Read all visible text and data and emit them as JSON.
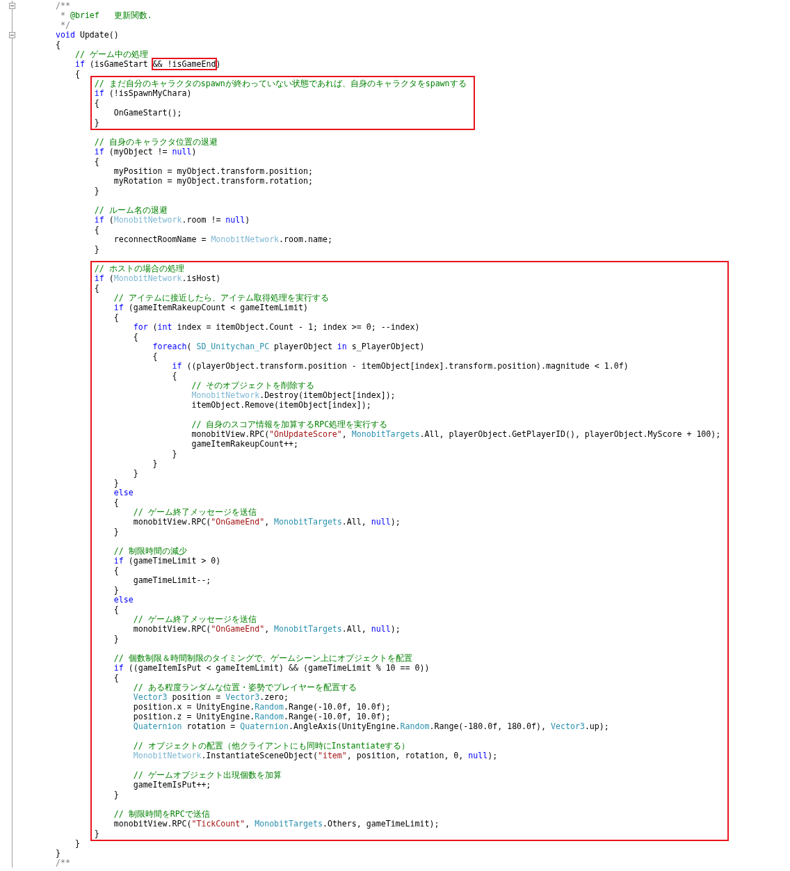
{
  "segments": [
    {
      "highlighted": false,
      "lines": [
        {
          "kind": "fold",
          "tokens": [
            {
              "kind": "dc",
              "text": "/**"
            }
          ]
        },
        {
          "kind": "code",
          "tokens": [
            {
              "kind": "dc",
              "text": " * "
            },
            {
              "kind": "c",
              "text": "@brief   更新関数."
            }
          ]
        },
        {
          "kind": "code",
          "tokens": [
            {
              "kind": "dc",
              "text": " */"
            }
          ]
        },
        {
          "kind": "fold",
          "tokens": [
            {
              "kind": "kw",
              "text": "void"
            },
            {
              "kind": "p",
              "text": " Update()"
            }
          ]
        },
        {
          "kind": "code",
          "tokens": [
            {
              "kind": "p",
              "text": "{"
            }
          ]
        },
        {
          "kind": "code",
          "tokens": [
            {
              "kind": "c",
              "text": "    // ゲーム中の処理"
            }
          ]
        },
        {
          "kind": "code",
          "tokens": [
            {
              "kind": "kw",
              "text": "    if"
            },
            {
              "kind": "p",
              "text": " (isGameStart "
            },
            {
              "kind": "box",
              "text": "&& !isGameEnd"
            },
            {
              "kind": "p",
              "text": ")"
            }
          ]
        },
        {
          "kind": "code",
          "tokens": [
            {
              "kind": "p",
              "text": "    {"
            }
          ]
        }
      ]
    },
    {
      "highlighted": true,
      "lines": [
        {
          "kind": "code",
          "tokens": [
            {
              "kind": "c",
              "text": "// まだ自分のキャラクタのspawnが終わっていない状態であれば、自身のキャラクタをspawnする"
            }
          ]
        },
        {
          "kind": "code",
          "tokens": [
            {
              "kind": "kw",
              "text": "if"
            },
            {
              "kind": "p",
              "text": " (!isSpawnMyChara)"
            }
          ]
        },
        {
          "kind": "code",
          "tokens": [
            {
              "kind": "p",
              "text": "{"
            }
          ]
        },
        {
          "kind": "code",
          "tokens": [
            {
              "kind": "p",
              "text": "    OnGameStart();"
            }
          ]
        },
        {
          "kind": "code",
          "tokens": [
            {
              "kind": "p",
              "text": "}"
            }
          ]
        }
      ]
    },
    {
      "highlighted": false,
      "lines": [
        {
          "kind": "blank"
        },
        {
          "kind": "code",
          "tokens": [
            {
              "kind": "c",
              "text": "        // 自身のキャラクタ位置の退避"
            }
          ]
        },
        {
          "kind": "code",
          "tokens": [
            {
              "kind": "kw",
              "text": "        if"
            },
            {
              "kind": "p",
              "text": " (myObject != "
            },
            {
              "kind": "kw",
              "text": "null"
            },
            {
              "kind": "p",
              "text": ")"
            }
          ]
        },
        {
          "kind": "code",
          "tokens": [
            {
              "kind": "p",
              "text": "        {"
            }
          ]
        },
        {
          "kind": "code",
          "tokens": [
            {
              "kind": "p",
              "text": "            myPosition = myObject.transform.position;"
            }
          ]
        },
        {
          "kind": "code",
          "tokens": [
            {
              "kind": "p",
              "text": "            myRotation = myObject.transform.rotation;"
            }
          ]
        },
        {
          "kind": "code",
          "tokens": [
            {
              "kind": "p",
              "text": "        }"
            }
          ]
        },
        {
          "kind": "blank"
        },
        {
          "kind": "code",
          "tokens": [
            {
              "kind": "c",
              "text": "        // ルーム名の退避"
            }
          ]
        },
        {
          "kind": "code",
          "tokens": [
            {
              "kind": "kw",
              "text": "        if"
            },
            {
              "kind": "p",
              "text": " ("
            },
            {
              "kind": "ty2",
              "text": "MonobitNetwork"
            },
            {
              "kind": "p",
              "text": ".room != "
            },
            {
              "kind": "kw",
              "text": "null"
            },
            {
              "kind": "p",
              "text": ")"
            }
          ]
        },
        {
          "kind": "code",
          "tokens": [
            {
              "kind": "p",
              "text": "        {"
            }
          ]
        },
        {
          "kind": "code",
          "tokens": [
            {
              "kind": "p",
              "text": "            reconnectRoomName = "
            },
            {
              "kind": "ty2",
              "text": "MonobitNetwork"
            },
            {
              "kind": "p",
              "text": ".room.name;"
            }
          ]
        },
        {
          "kind": "code",
          "tokens": [
            {
              "kind": "p",
              "text": "        }"
            }
          ]
        },
        {
          "kind": "blank"
        }
      ]
    },
    {
      "highlighted": true,
      "lines": [
        {
          "kind": "code",
          "tokens": [
            {
              "kind": "c",
              "text": "// ホストの場合の処理"
            }
          ]
        },
        {
          "kind": "code",
          "tokens": [
            {
              "kind": "kw",
              "text": "if"
            },
            {
              "kind": "p",
              "text": " ("
            },
            {
              "kind": "ty2",
              "text": "MonobitNetwork"
            },
            {
              "kind": "p",
              "text": ".isHost)"
            }
          ]
        },
        {
          "kind": "code",
          "tokens": [
            {
              "kind": "p",
              "text": "{"
            }
          ]
        },
        {
          "kind": "code",
          "tokens": [
            {
              "kind": "c",
              "text": "    // アイテムに接近したら、アイテム取得処理を実行する"
            }
          ]
        },
        {
          "kind": "code",
          "tokens": [
            {
              "kind": "kw",
              "text": "    if"
            },
            {
              "kind": "p",
              "text": " (gameItemRakeupCount < gameItemLimit)"
            }
          ]
        },
        {
          "kind": "code",
          "tokens": [
            {
              "kind": "p",
              "text": "    {"
            }
          ]
        },
        {
          "kind": "code",
          "tokens": [
            {
              "kind": "kw",
              "text": "        for"
            },
            {
              "kind": "p",
              "text": " ("
            },
            {
              "kind": "kw",
              "text": "int"
            },
            {
              "kind": "p",
              "text": " index = itemObject.Count - 1; index >= 0; --index)"
            }
          ]
        },
        {
          "kind": "code",
          "tokens": [
            {
              "kind": "p",
              "text": "        {"
            }
          ]
        },
        {
          "kind": "code",
          "tokens": [
            {
              "kind": "kw",
              "text": "            foreach"
            },
            {
              "kind": "p",
              "text": "( "
            },
            {
              "kind": "ty",
              "text": "SD_Unitychan_PC"
            },
            {
              "kind": "p",
              "text": " playerObject "
            },
            {
              "kind": "kw",
              "text": "in"
            },
            {
              "kind": "p",
              "text": " s_PlayerObject)"
            }
          ]
        },
        {
          "kind": "code",
          "tokens": [
            {
              "kind": "p",
              "text": "            {"
            }
          ]
        },
        {
          "kind": "code",
          "tokens": [
            {
              "kind": "kw",
              "text": "                if"
            },
            {
              "kind": "p",
              "text": " ((playerObject.transform.position - itemObject[index].transform.position).magnitude < 1.0f)"
            }
          ]
        },
        {
          "kind": "code",
          "tokens": [
            {
              "kind": "p",
              "text": "                {"
            }
          ]
        },
        {
          "kind": "code",
          "tokens": [
            {
              "kind": "c",
              "text": "                    // そのオブジェクトを削除する"
            }
          ]
        },
        {
          "kind": "code",
          "tokens": [
            {
              "kind": "ty2",
              "text": "                    MonobitNetwork"
            },
            {
              "kind": "p",
              "text": ".Destroy(itemObject[index]);"
            }
          ]
        },
        {
          "kind": "code",
          "tokens": [
            {
              "kind": "p",
              "text": "                    itemObject.Remove(itemObject[index]);"
            }
          ]
        },
        {
          "kind": "blank"
        },
        {
          "kind": "code",
          "tokens": [
            {
              "kind": "c",
              "text": "                    // 自身のスコア情報を加算するRPC処理を実行する"
            }
          ]
        },
        {
          "kind": "code",
          "tokens": [
            {
              "kind": "p",
              "text": "                    monobitView.RPC("
            },
            {
              "kind": "s",
              "text": "\"OnUpdateScore\""
            },
            {
              "kind": "p",
              "text": ", "
            },
            {
              "kind": "ty",
              "text": "MonobitTargets"
            },
            {
              "kind": "p",
              "text": ".All, playerObject.GetPlayerID(), playerObject.MyScore + 100);"
            }
          ]
        },
        {
          "kind": "code",
          "tokens": [
            {
              "kind": "p",
              "text": "                    gameItemRakeupCount++;"
            }
          ]
        },
        {
          "kind": "code",
          "tokens": [
            {
              "kind": "p",
              "text": "                }"
            }
          ]
        },
        {
          "kind": "code",
          "tokens": [
            {
              "kind": "p",
              "text": "            }"
            }
          ]
        },
        {
          "kind": "code",
          "tokens": [
            {
              "kind": "p",
              "text": "        }"
            }
          ]
        },
        {
          "kind": "code",
          "tokens": [
            {
              "kind": "p",
              "text": "    }"
            }
          ]
        },
        {
          "kind": "code",
          "tokens": [
            {
              "kind": "kw",
              "text": "    else"
            }
          ]
        },
        {
          "kind": "code",
          "tokens": [
            {
              "kind": "p",
              "text": "    {"
            }
          ]
        },
        {
          "kind": "code",
          "tokens": [
            {
              "kind": "c",
              "text": "        // ゲーム終了メッセージを送信"
            }
          ]
        },
        {
          "kind": "code",
          "tokens": [
            {
              "kind": "p",
              "text": "        monobitView.RPC("
            },
            {
              "kind": "s",
              "text": "\"OnGameEnd\""
            },
            {
              "kind": "p",
              "text": ", "
            },
            {
              "kind": "ty",
              "text": "MonobitTargets"
            },
            {
              "kind": "p",
              "text": ".All, "
            },
            {
              "kind": "kw",
              "text": "null"
            },
            {
              "kind": "p",
              "text": ");"
            }
          ]
        },
        {
          "kind": "code",
          "tokens": [
            {
              "kind": "p",
              "text": "    }"
            }
          ]
        },
        {
          "kind": "blank"
        },
        {
          "kind": "code",
          "tokens": [
            {
              "kind": "c",
              "text": "    // 制限時間の減少"
            }
          ]
        },
        {
          "kind": "code",
          "tokens": [
            {
              "kind": "kw",
              "text": "    if"
            },
            {
              "kind": "p",
              "text": " (gameTimeLimit > 0)"
            }
          ]
        },
        {
          "kind": "code",
          "tokens": [
            {
              "kind": "p",
              "text": "    {"
            }
          ]
        },
        {
          "kind": "code",
          "tokens": [
            {
              "kind": "p",
              "text": "        gameTimeLimit--;"
            }
          ]
        },
        {
          "kind": "code",
          "tokens": [
            {
              "kind": "p",
              "text": "    }"
            }
          ]
        },
        {
          "kind": "code",
          "tokens": [
            {
              "kind": "kw",
              "text": "    else"
            }
          ]
        },
        {
          "kind": "code",
          "tokens": [
            {
              "kind": "p",
              "text": "    {"
            }
          ]
        },
        {
          "kind": "code",
          "tokens": [
            {
              "kind": "c",
              "text": "        // ゲーム終了メッセージを送信"
            }
          ]
        },
        {
          "kind": "code",
          "tokens": [
            {
              "kind": "p",
              "text": "        monobitView.RPC("
            },
            {
              "kind": "s",
              "text": "\"OnGameEnd\""
            },
            {
              "kind": "p",
              "text": ", "
            },
            {
              "kind": "ty",
              "text": "MonobitTargets"
            },
            {
              "kind": "p",
              "text": ".All, "
            },
            {
              "kind": "kw",
              "text": "null"
            },
            {
              "kind": "p",
              "text": ");"
            }
          ]
        },
        {
          "kind": "code",
          "tokens": [
            {
              "kind": "p",
              "text": "    }"
            }
          ]
        },
        {
          "kind": "blank"
        },
        {
          "kind": "code",
          "tokens": [
            {
              "kind": "c",
              "text": "    // 個数制限＆時間制限のタイミングで、ゲームシーン上にオブジェクトを配置"
            }
          ]
        },
        {
          "kind": "code",
          "tokens": [
            {
              "kind": "kw",
              "text": "    if"
            },
            {
              "kind": "p",
              "text": " ((gameItemIsPut < gameItemLimit) && (gameTimeLimit % 10 == 0))"
            }
          ]
        },
        {
          "kind": "code",
          "tokens": [
            {
              "kind": "p",
              "text": "    {"
            }
          ]
        },
        {
          "kind": "code",
          "tokens": [
            {
              "kind": "c",
              "text": "        // ある程度ランダムな位置・姿勢でプレイヤーを配置する"
            }
          ]
        },
        {
          "kind": "code",
          "tokens": [
            {
              "kind": "ty",
              "text": "        Vector3"
            },
            {
              "kind": "p",
              "text": " position = "
            },
            {
              "kind": "ty",
              "text": "Vector3"
            },
            {
              "kind": "p",
              "text": ".zero;"
            }
          ]
        },
        {
          "kind": "code",
          "tokens": [
            {
              "kind": "p",
              "text": "        position.x = UnityEngine."
            },
            {
              "kind": "ty",
              "text": "Random"
            },
            {
              "kind": "p",
              "text": ".Range(-10.0f, 10.0f);"
            }
          ]
        },
        {
          "kind": "code",
          "tokens": [
            {
              "kind": "p",
              "text": "        position.z = UnityEngine."
            },
            {
              "kind": "ty",
              "text": "Random"
            },
            {
              "kind": "p",
              "text": ".Range(-10.0f, 10.0f);"
            }
          ]
        },
        {
          "kind": "code",
          "tokens": [
            {
              "kind": "ty",
              "text": "        Quaternion"
            },
            {
              "kind": "p",
              "text": " rotation = "
            },
            {
              "kind": "ty",
              "text": "Quaternion"
            },
            {
              "kind": "p",
              "text": ".AngleAxis(UnityEngine."
            },
            {
              "kind": "ty",
              "text": "Random"
            },
            {
              "kind": "p",
              "text": ".Range(-180.0f, 180.0f), "
            },
            {
              "kind": "ty",
              "text": "Vector3"
            },
            {
              "kind": "p",
              "text": ".up);"
            }
          ]
        },
        {
          "kind": "blank"
        },
        {
          "kind": "code",
          "tokens": [
            {
              "kind": "c",
              "text": "        // オブジェクトの配置（他クライアントにも同時にInstantiateする）"
            }
          ]
        },
        {
          "kind": "code",
          "tokens": [
            {
              "kind": "ty2",
              "text": "        MonobitNetwork"
            },
            {
              "kind": "p",
              "text": ".InstantiateSceneObject("
            },
            {
              "kind": "s",
              "text": "\"item\""
            },
            {
              "kind": "p",
              "text": ", position, rotation, 0, "
            },
            {
              "kind": "kw",
              "text": "null"
            },
            {
              "kind": "p",
              "text": ");"
            }
          ]
        },
        {
          "kind": "blank"
        },
        {
          "kind": "code",
          "tokens": [
            {
              "kind": "c",
              "text": "        // ゲームオブジェクト出現個数を加算"
            }
          ]
        },
        {
          "kind": "code",
          "tokens": [
            {
              "kind": "p",
              "text": "        gameItemIsPut++;"
            }
          ]
        },
        {
          "kind": "code",
          "tokens": [
            {
              "kind": "p",
              "text": "    }"
            }
          ]
        },
        {
          "kind": "blank"
        },
        {
          "kind": "code",
          "tokens": [
            {
              "kind": "c",
              "text": "    // 制限時間をRPCで送信"
            }
          ]
        },
        {
          "kind": "code",
          "tokens": [
            {
              "kind": "p",
              "text": "    monobitView.RPC("
            },
            {
              "kind": "s",
              "text": "\"TickCount\""
            },
            {
              "kind": "p",
              "text": ", "
            },
            {
              "kind": "ty",
              "text": "MonobitTargets"
            },
            {
              "kind": "p",
              "text": ".Others, gameTimeLimit);"
            }
          ]
        },
        {
          "kind": "code",
          "tokens": [
            {
              "kind": "p",
              "text": "}"
            }
          ]
        }
      ]
    },
    {
      "highlighted": false,
      "lines": [
        {
          "kind": "code",
          "tokens": [
            {
              "kind": "p",
              "text": "    }"
            }
          ]
        },
        {
          "kind": "code",
          "tokens": [
            {
              "kind": "p",
              "text": "}"
            }
          ]
        },
        {
          "kind": "code",
          "tokens": [
            {
              "kind": "dc",
              "text": "/**"
            }
          ]
        }
      ]
    }
  ]
}
